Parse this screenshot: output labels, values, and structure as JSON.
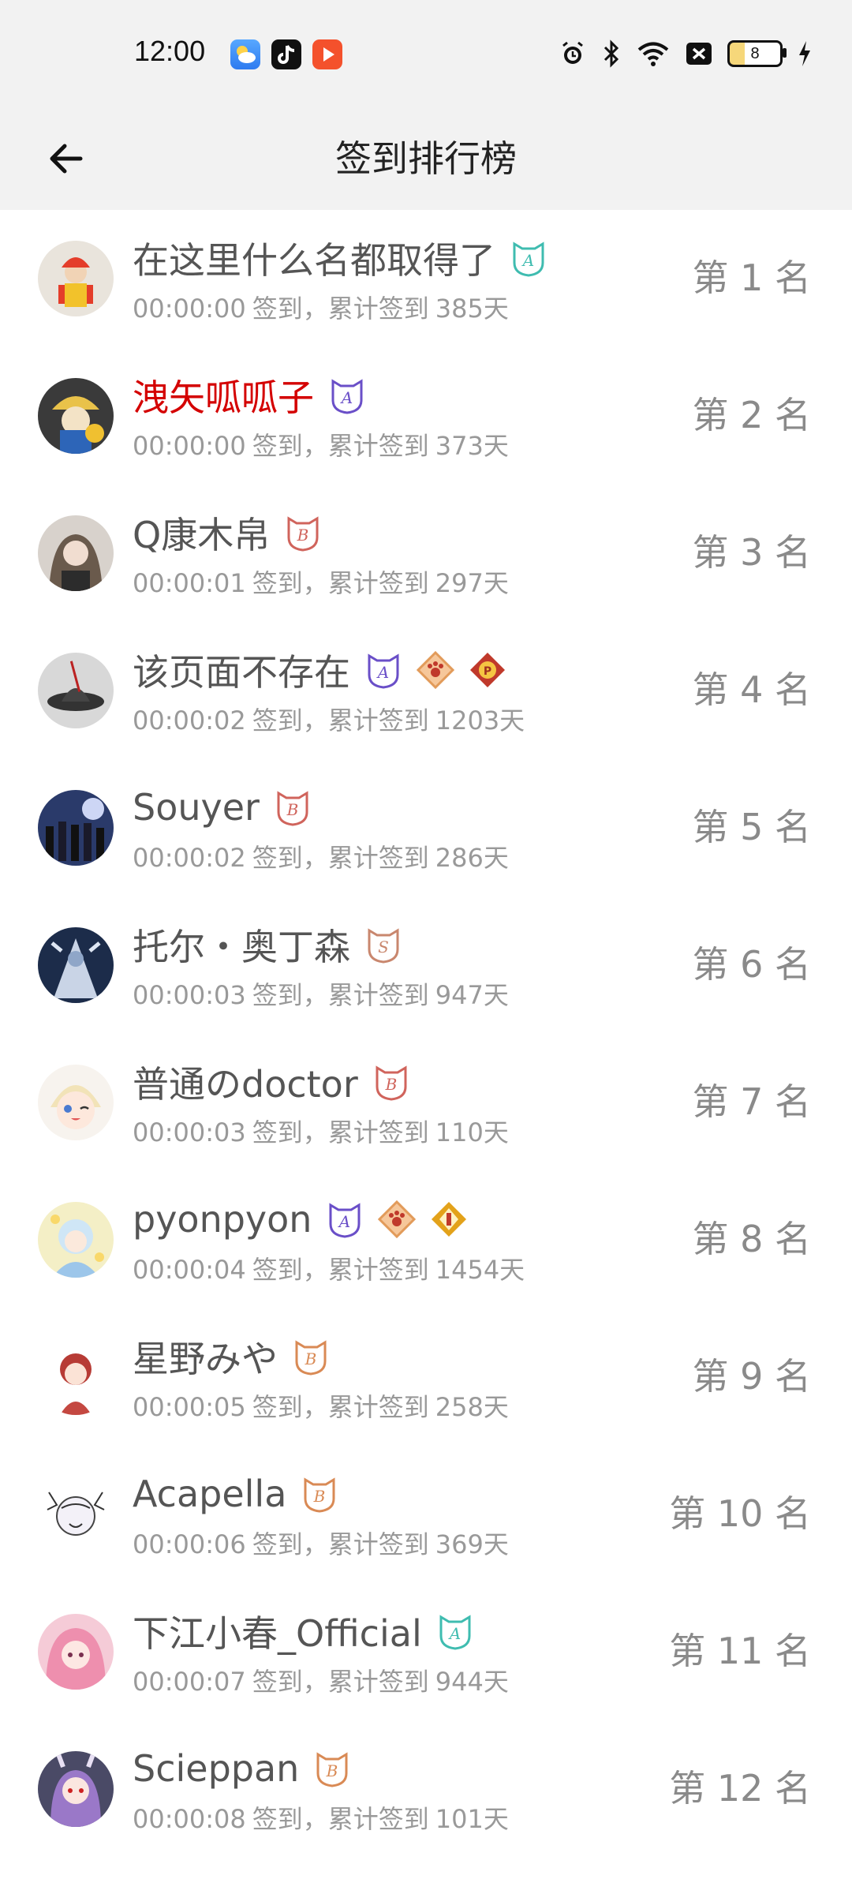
{
  "status_bar": {
    "time": "12:00",
    "battery": "8",
    "app_icons": [
      "weather-app-icon",
      "tiktok-app-icon",
      "video-app-icon"
    ]
  },
  "header": {
    "title": "签到排行榜"
  },
  "sub_template": {
    "signin": "签到，累计签到",
    "days_unit": "天"
  },
  "ranking": [
    {
      "name": "在这里什么名都取得了",
      "time": "00:00:00",
      "total_days": "385",
      "rank": "第 1 名",
      "name_color": "#555555",
      "badges": [
        "badge-a-teal"
      ]
    },
    {
      "name": "洩矢呱呱子",
      "time": "00:00:00",
      "total_days": "373",
      "rank": "第 2 名",
      "name_color": "#d40000",
      "badges": [
        "badge-a-purple"
      ]
    },
    {
      "name": "Q康木帛",
      "time": "00:00:01",
      "total_days": "297",
      "rank": "第 3 名",
      "name_color": "#555555",
      "badges": [
        "badge-b-red"
      ]
    },
    {
      "name": "该页面不存在",
      "time": "00:00:02",
      "total_days": "1203",
      "rank": "第 4 名",
      "name_color": "#555555",
      "badges": [
        "badge-a-purple",
        "badge-paw-orange",
        "badge-medal-red"
      ]
    },
    {
      "name": "Souyer",
      "time": "00:00:02",
      "total_days": "286",
      "rank": "第 5 名",
      "name_color": "#555555",
      "badges": [
        "badge-b-red"
      ]
    },
    {
      "name": "托尔・奥丁森",
      "time": "00:00:03",
      "total_days": "947",
      "rank": "第 6 名",
      "name_color": "#555555",
      "badges": [
        "badge-s-brown"
      ]
    },
    {
      "name": "普通のdoctor",
      "time": "00:00:03",
      "total_days": "110",
      "rank": "第 7 名",
      "name_color": "#555555",
      "badges": [
        "badge-b-red"
      ]
    },
    {
      "name": "pyonpyon",
      "time": "00:00:04",
      "total_days": "1454",
      "rank": "第 8 名",
      "name_color": "#555555",
      "badges": [
        "badge-a-purple",
        "badge-paw-orange",
        "badge-medal-gold"
      ]
    },
    {
      "name": "星野みや",
      "time": "00:00:05",
      "total_days": "258",
      "rank": "第 9 名",
      "name_color": "#555555",
      "badges": [
        "badge-b-orange"
      ]
    },
    {
      "name": "Acapella",
      "time": "00:00:06",
      "total_days": "369",
      "rank": "第 10 名",
      "name_color": "#555555",
      "badges": [
        "badge-b-orange"
      ]
    },
    {
      "name": "下江小春_Official",
      "time": "00:00:07",
      "total_days": "944",
      "rank": "第 11 名",
      "name_color": "#555555",
      "badges": [
        "badge-a-teal"
      ]
    },
    {
      "name": "Scieppan",
      "time": "00:00:08",
      "total_days": "101",
      "rank": "第 12 名",
      "name_color": "#555555",
      "badges": [
        "badge-b-orange"
      ]
    }
  ],
  "colors": {
    "badge-a-teal": "#3fbcb0",
    "badge-a-purple": "#6a4fc8",
    "badge-b-red": "#d0645c",
    "badge-b-orange": "#d98a55",
    "badge-s-brown": "#c9876e",
    "badge-paw-orange": "#e29b5a",
    "badge-medal-red": "#c0392b",
    "badge-medal-gold": "#e3a21a"
  }
}
